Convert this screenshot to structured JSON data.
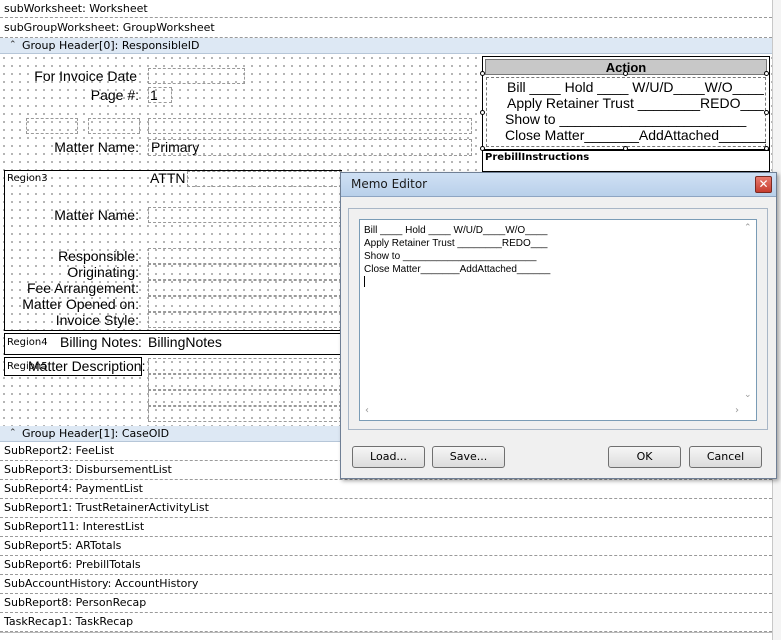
{
  "bands_top": [
    "subWorksheet: Worksheet",
    "subGroupWorksheet: GroupWorksheet"
  ],
  "group_header_0": "Group Header[0]: ResponsibleID",
  "header_fields": {
    "invoice_date_label": "For Invoice Date",
    "page_label": "Page #:",
    "page_value": "1",
    "matter_name_label": "Matter Name:",
    "matter_name_value": "Primary"
  },
  "action_box": {
    "title": "Action",
    "lines": [
      "Bill ____ Hold ____ W/U/D____W/O____",
      "Apply Retainer Trust ________REDO___",
      "Show to ________________________",
      "Close Matter_______AddAttached______"
    ],
    "prebill_label": "PrebillInstructions"
  },
  "region3": {
    "name": "Region3",
    "attn": "ATTN",
    "matter_name_label": "Matter Name:",
    "labels": [
      "Responsible:",
      "Originating:",
      "Fee Arrangement:",
      "Matter Opened on:",
      "Invoice Style:"
    ]
  },
  "region4": {
    "name": "Region4",
    "label": "Billing Notes:",
    "value": "BillingNotes"
  },
  "region5": {
    "name": "Region5",
    "label": "Matter Description:"
  },
  "group_header_1": "Group Header[1]: CaseOID",
  "bands_bottom": [
    "SubReport2: FeeList",
    "SubReport3: DisbursementList",
    "SubReport4: PaymentList",
    "SubReport1: TrustRetainerActivityList",
    "SubReport11: InterestList",
    "SubReport5: ARTotals",
    "SubReport6: PrebillTotals",
    "SubAccountHistory: AccountHistory",
    "SubReport8: PersonRecap",
    "TaskRecap1: TaskRecap"
  ],
  "memo_editor": {
    "title": "Memo Editor",
    "close": "✕",
    "text": "Bill ____ Hold ____ W/U/D____W/O____\nApply Retainer Trust ________REDO___\nShow to ________________________\nClose Matter_______AddAttached______\n",
    "load_label": "Load...",
    "save_label": "Save...",
    "ok_label": "OK",
    "cancel_label": "Cancel"
  }
}
